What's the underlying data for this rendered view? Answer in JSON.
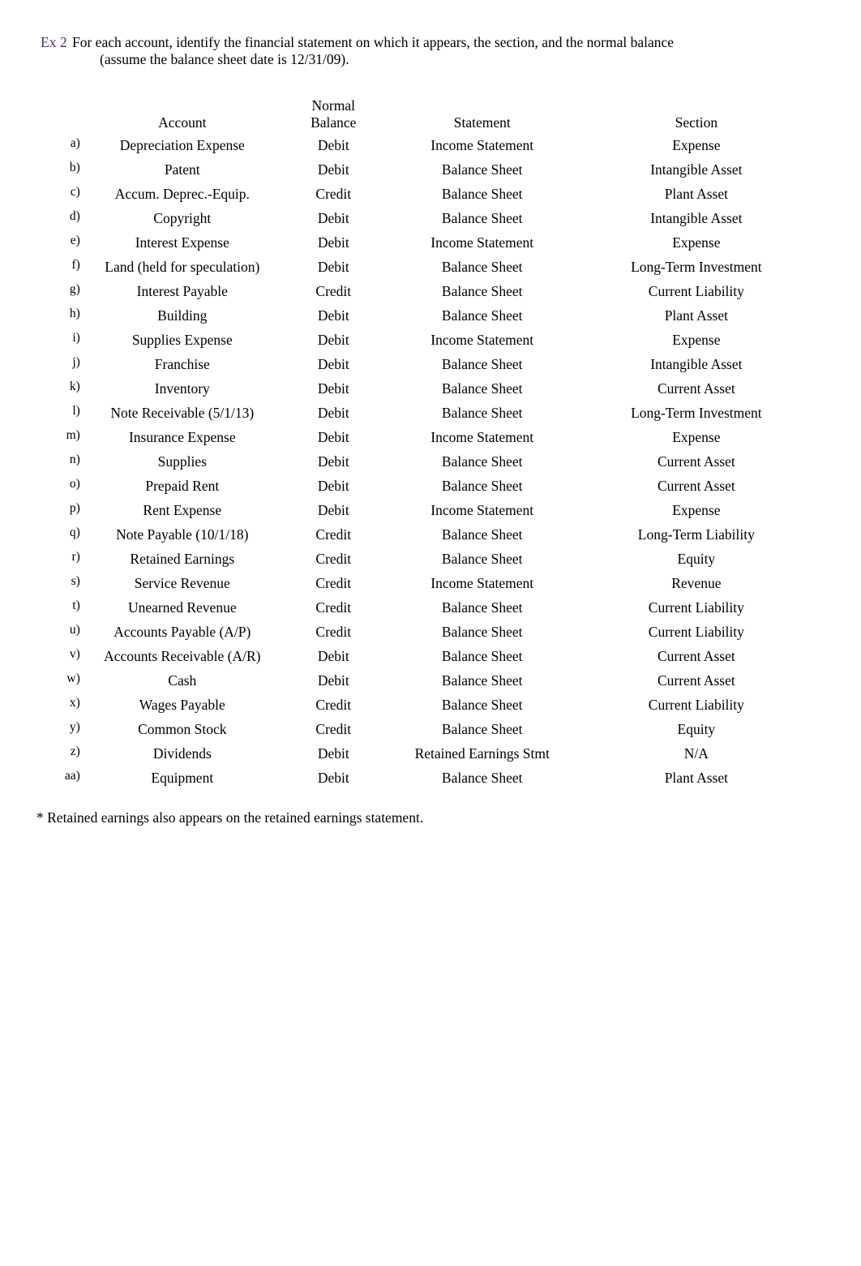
{
  "heading": {
    "exercise_label": "Ex 2",
    "prompt_line_1": "For each account, identify the financial statement on which it appears, the section, and the normal balance",
    "prompt_line_2": "(assume the balance sheet date is 12/31/09).",
    "exercise_label_color": "#4b2a72"
  },
  "table": {
    "columns": [
      {
        "key": "letter",
        "label": ""
      },
      {
        "key": "account",
        "label": "Account"
      },
      {
        "key": "balance",
        "label_line_1": "Normal",
        "label_line_2": "Balance"
      },
      {
        "key": "statement",
        "label": "Statement"
      },
      {
        "key": "section",
        "label": "Section"
      }
    ],
    "rows": [
      {
        "letter": "a)",
        "account": "Depreciation Expense",
        "balance": "Debit",
        "statement": "Income Statement",
        "section": "Expense"
      },
      {
        "letter": "b)",
        "account": "Patent",
        "balance": "Debit",
        "statement": "Balance Sheet",
        "section": "Intangible Asset"
      },
      {
        "letter": "c)",
        "account": "Accum. Deprec.-Equip.",
        "balance": "Credit",
        "statement": "Balance Sheet",
        "section": "Plant Asset"
      },
      {
        "letter": "d)",
        "account": "Copyright",
        "balance": "Debit",
        "statement": "Balance Sheet",
        "section": "Intangible Asset"
      },
      {
        "letter": "e)",
        "account": "Interest Expense",
        "balance": "Debit",
        "statement": "Income Statement",
        "section": "Expense"
      },
      {
        "letter": "f)",
        "account": "Land (held for speculation)",
        "balance": "Debit",
        "statement": "Balance Sheet",
        "section": "Long-Term Investment"
      },
      {
        "letter": "g)",
        "account": "Interest Payable",
        "balance": "Credit",
        "statement": "Balance Sheet",
        "section": "Current Liability"
      },
      {
        "letter": "h)",
        "account": "Building",
        "balance": "Debit",
        "statement": "Balance Sheet",
        "section": "Plant Asset"
      },
      {
        "letter": "i)",
        "account": "Supplies Expense",
        "balance": "Debit",
        "statement": "Income Statement",
        "section": "Expense"
      },
      {
        "letter": "j)",
        "account": "Franchise",
        "balance": "Debit",
        "statement": "Balance Sheet",
        "section": "Intangible Asset"
      },
      {
        "letter": "k)",
        "account": "Inventory",
        "balance": "Debit",
        "statement": "Balance Sheet",
        "section": "Current Asset"
      },
      {
        "letter": "l)",
        "account": "Note Receivable (5/1/13)",
        "balance": "Debit",
        "statement": "Balance Sheet",
        "section": "Long-Term Investment"
      },
      {
        "letter": "m)",
        "account": "Insurance Expense",
        "balance": "Debit",
        "statement": "Income Statement",
        "section": "Expense"
      },
      {
        "letter": "n)",
        "account": "Supplies",
        "balance": "Debit",
        "statement": "Balance Sheet",
        "section": "Current Asset"
      },
      {
        "letter": "o)",
        "account": "Prepaid Rent",
        "balance": "Debit",
        "statement": "Balance Sheet",
        "section": "Current Asset"
      },
      {
        "letter": "p)",
        "account": "Rent Expense",
        "balance": "Debit",
        "statement": "Income Statement",
        "section": "Expense"
      },
      {
        "letter": "q)",
        "account": "Note Payable (10/1/18)",
        "balance": "Credit",
        "statement": "Balance Sheet",
        "section": "Long-Term Liability"
      },
      {
        "letter": "r)",
        "account": "Retained Earnings",
        "balance": "Credit",
        "statement": "Balance Sheet",
        "section": "Equity"
      },
      {
        "letter": "s)",
        "account": "Service Revenue",
        "balance": "Credit",
        "statement": "Income Statement",
        "section": "Revenue"
      },
      {
        "letter": "t)",
        "account": "Unearned Revenue",
        "balance": "Credit",
        "statement": "Balance Sheet",
        "section": "Current Liability"
      },
      {
        "letter": "u)",
        "account": "Accounts Payable (A/P)",
        "balance": "Credit",
        "statement": "Balance Sheet",
        "section": "Current Liability"
      },
      {
        "letter": "v)",
        "account": "Accounts Receivable (A/R)",
        "balance": "Debit",
        "statement": "Balance Sheet",
        "section": "Current Asset"
      },
      {
        "letter": "w)",
        "account": "Cash",
        "balance": "Debit",
        "statement": "Balance Sheet",
        "section": "Current Asset"
      },
      {
        "letter": "x)",
        "account": "Wages Payable",
        "balance": "Credit",
        "statement": "Balance Sheet",
        "section": "Current Liability"
      },
      {
        "letter": "y)",
        "account": "Common Stock",
        "balance": "Credit",
        "statement": "Balance Sheet",
        "section": "Equity"
      },
      {
        "letter": "z)",
        "account": "Dividends",
        "balance": "Debit",
        "statement": "Retained Earnings Stmt",
        "section": "N/A"
      },
      {
        "letter": "aa)",
        "account": "Equipment",
        "balance": "Debit",
        "statement": "Balance Sheet",
        "section": "Plant Asset"
      }
    ]
  },
  "footnote": "* Retained earnings also appears on the retained earnings statement."
}
